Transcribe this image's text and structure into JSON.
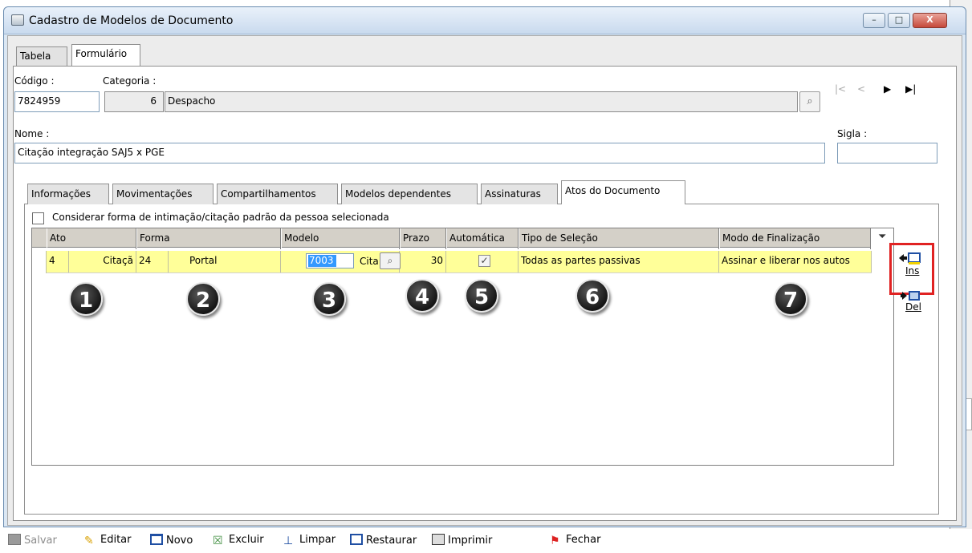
{
  "window": {
    "title": "Cadastro de Modelos de Documento",
    "buttons": {
      "minimize": "–",
      "maximize": "□",
      "close": "X"
    }
  },
  "top_tabs": [
    {
      "label": "Tabela"
    },
    {
      "label": "Formulário"
    }
  ],
  "form": {
    "codigo_label": "Código :",
    "codigo_value": "7824959",
    "categoria_label": "Categoria :",
    "categoria_code": "6",
    "categoria_desc": "Despacho",
    "nome_label": "Nome :",
    "nome_value": "Citação integração SAJ5 x PGE",
    "sigla_label": "Sigla :",
    "sigla_value": ""
  },
  "navigation": {
    "first": "|<",
    "prev": "<",
    "next": "▶",
    "last": "▶|"
  },
  "inner_tabs": [
    {
      "label": "Informações"
    },
    {
      "label": "Movimentações"
    },
    {
      "label": "Compartilhamentos"
    },
    {
      "label": "Modelos dependentes"
    },
    {
      "label": "Assinaturas"
    },
    {
      "label": "Atos do Documento"
    }
  ],
  "checkbox_label": "Considerar forma de intimação/citação padrão da pessoa selecionada",
  "grid": {
    "columns": [
      "Ato",
      "Forma",
      "Modelo",
      "Prazo",
      "Automática",
      "Tipo de Seleção",
      "Modo de Finalização"
    ],
    "row": {
      "ato_code": "4",
      "ato_desc": "Citaçã",
      "forma_code": "24",
      "forma_desc": "Portal",
      "modelo_code": "7003",
      "modelo_desc": "Cita",
      "prazo": "30",
      "automatica_checked": true,
      "tipo_selecao": "Todas as partes passivas",
      "modo_finalizacao": "Assinar e liberar nos autos"
    }
  },
  "callouts": [
    "1",
    "2",
    "3",
    "4",
    "5",
    "6",
    "7"
  ],
  "side_buttons": {
    "ins": "Ins",
    "del": "Del"
  },
  "toolbar": {
    "salvar": "Salvar",
    "editar": "Editar",
    "novo": "Novo",
    "excluir": "Excluir",
    "limpar": "Limpar",
    "restaurar": "Restaurar",
    "imprimir": "Imprimir",
    "fechar": "Fechar"
  }
}
